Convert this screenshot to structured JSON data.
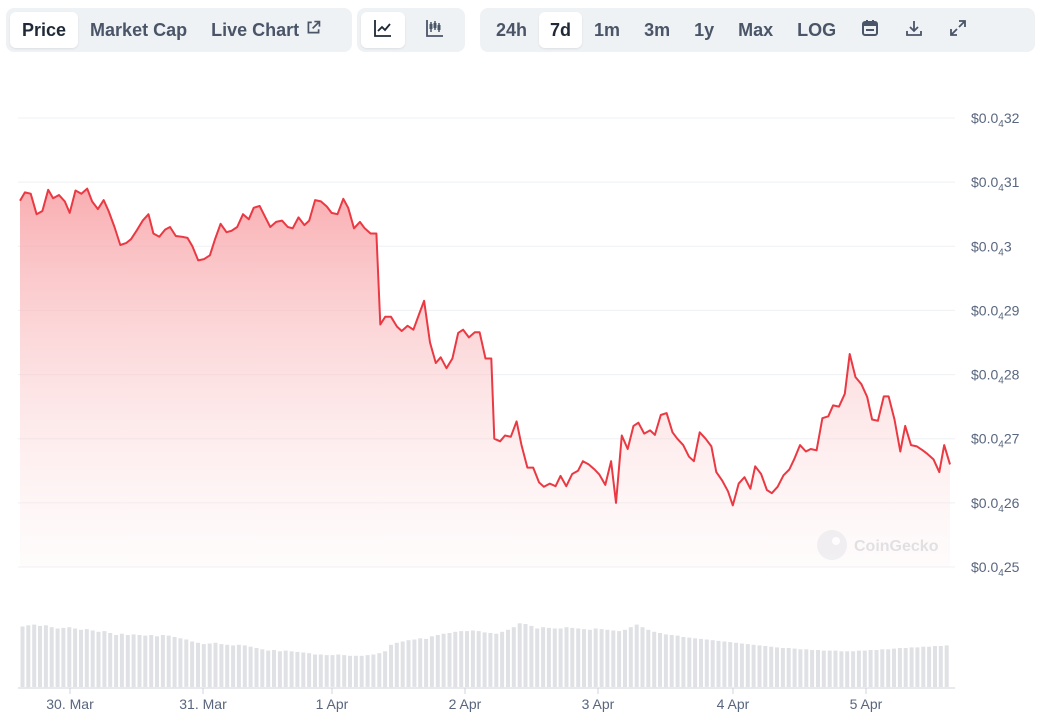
{
  "toolbar": {
    "metric_tabs": [
      {
        "label": "Price",
        "active": true
      },
      {
        "label": "Market Cap",
        "active": false
      },
      {
        "label": "Live Chart",
        "active": false,
        "icon": "external-link-icon"
      }
    ],
    "chart_type_buttons": [
      {
        "icon": "line-chart-icon",
        "active": true
      },
      {
        "icon": "candlestick-icon",
        "active": false
      }
    ],
    "range_buttons": [
      {
        "label": "24h",
        "active": false
      },
      {
        "label": "7d",
        "active": true
      },
      {
        "label": "1m",
        "active": false
      },
      {
        "label": "3m",
        "active": false
      },
      {
        "label": "1y",
        "active": false
      },
      {
        "label": "Max",
        "active": false
      },
      {
        "label": "LOG",
        "active": false
      }
    ],
    "action_icons": [
      "calendar-icon",
      "download-icon",
      "expand-icon"
    ]
  },
  "watermark": "CoinGecko",
  "colors": {
    "line": "#ea3943",
    "fill_top": "#f8a5a9",
    "grid": "#eef0f3",
    "volume": "#dfe1e5",
    "axis_text": "#58667e"
  },
  "chart_data": {
    "type": "area",
    "y_ticks": [
      {
        "prefix": "$0.0",
        "sub": "4",
        "suffix": "32",
        "value": 3.2e-05
      },
      {
        "prefix": "$0.0",
        "sub": "4",
        "suffix": "31",
        "value": 3.1e-05
      },
      {
        "prefix": "$0.0",
        "sub": "4",
        "suffix": "3",
        "value": 3e-05
      },
      {
        "prefix": "$0.0",
        "sub": "4",
        "suffix": "29",
        "value": 2.9e-05
      },
      {
        "prefix": "$0.0",
        "sub": "4",
        "suffix": "28",
        "value": 2.8e-05
      },
      {
        "prefix": "$0.0",
        "sub": "4",
        "suffix": "27",
        "value": 2.7e-05
      },
      {
        "prefix": "$0.0",
        "sub": "4",
        "suffix": "26",
        "value": 2.6e-05
      },
      {
        "prefix": "$0.0",
        "sub": "4",
        "suffix": "25",
        "value": 2.5e-05
      }
    ],
    "ylim": [
      2.5e-05,
      3.2e-05
    ],
    "x_ticks": [
      {
        "label": "30. Mar",
        "day": 0.5
      },
      {
        "label": "31. Mar",
        "day": 1.5
      },
      {
        "label": "1 Apr",
        "day": 2.5
      },
      {
        "label": "2 Apr",
        "day": 3.5
      },
      {
        "label": "3 Apr",
        "day": 4.5
      },
      {
        "label": "4 Apr",
        "day": 5.5
      },
      {
        "label": "5 Apr",
        "day": 6.5
      }
    ],
    "xlim": [
      0,
      7
    ],
    "price_points": [
      [
        0.0,
        0.03071
      ],
      [
        0.05,
        0.03084
      ],
      [
        0.11,
        0.03082
      ],
      [
        0.17,
        0.0305
      ],
      [
        0.23,
        0.03055
      ],
      [
        0.29,
        0.03088
      ],
      [
        0.34,
        0.03075
      ],
      [
        0.4,
        0.0308
      ],
      [
        0.46,
        0.0307
      ],
      [
        0.51,
        0.03052
      ],
      [
        0.57,
        0.03087
      ],
      [
        0.63,
        0.03082
      ],
      [
        0.69,
        0.0309
      ],
      [
        0.74,
        0.0307
      ],
      [
        0.8,
        0.03058
      ],
      [
        0.86,
        0.03072
      ],
      [
        0.91,
        0.03055
      ],
      [
        0.97,
        0.0303
      ],
      [
        1.03,
        0.03002
      ],
      [
        1.09,
        0.03005
      ],
      [
        1.14,
        0.03011
      ],
      [
        1.2,
        0.03025
      ],
      [
        1.26,
        0.0304
      ],
      [
        1.32,
        0.0305
      ],
      [
        1.37,
        0.0302
      ],
      [
        1.43,
        0.03015
      ],
      [
        1.49,
        0.03026
      ],
      [
        1.54,
        0.0303
      ],
      [
        1.6,
        0.03016
      ],
      [
        1.66,
        0.03015
      ],
      [
        1.72,
        0.03013
      ],
      [
        1.77,
        0.03
      ],
      [
        1.83,
        0.02978
      ],
      [
        1.89,
        0.0298
      ],
      [
        1.95,
        0.02986
      ],
      [
        2.0,
        0.0301
      ],
      [
        2.06,
        0.03035
      ],
      [
        2.12,
        0.03022
      ],
      [
        2.17,
        0.03024
      ],
      [
        2.23,
        0.0303
      ],
      [
        2.29,
        0.0305
      ],
      [
        2.35,
        0.03042
      ],
      [
        2.4,
        0.0306
      ],
      [
        2.46,
        0.03063
      ],
      [
        2.52,
        0.03045
      ],
      [
        2.57,
        0.0303
      ],
      [
        2.63,
        0.03038
      ],
      [
        2.69,
        0.0304
      ],
      [
        2.75,
        0.0303
      ],
      [
        2.8,
        0.03028
      ],
      [
        2.86,
        0.03045
      ],
      [
        2.92,
        0.03033
      ],
      [
        2.97,
        0.0304
      ],
      [
        3.03,
        0.03072
      ],
      [
        3.09,
        0.0307
      ],
      [
        3.15,
        0.03062
      ],
      [
        3.2,
        0.03052
      ],
      [
        3.26,
        0.0305
      ],
      [
        3.32,
        0.03074
      ],
      [
        3.37,
        0.0306
      ],
      [
        3.43,
        0.03028
      ],
      [
        3.49,
        0.03038
      ],
      [
        3.54,
        0.03028
      ],
      [
        3.6,
        0.0302
      ],
      [
        3.66,
        0.0302
      ],
      [
        3.7,
        0.02878
      ],
      [
        3.75,
        0.0289
      ],
      [
        3.81,
        0.0289
      ],
      [
        3.87,
        0.02875
      ],
      [
        3.92,
        0.02868
      ],
      [
        3.98,
        0.02876
      ],
      [
        4.04,
        0.0287
      ],
      [
        4.1,
        0.02895
      ],
      [
        4.15,
        0.02915
      ],
      [
        4.21,
        0.0285
      ],
      [
        4.27,
        0.02818
      ],
      [
        4.32,
        0.02827
      ],
      [
        4.38,
        0.0281
      ],
      [
        4.44,
        0.02825
      ],
      [
        4.5,
        0.02865
      ],
      [
        4.55,
        0.0287
      ],
      [
        4.61,
        0.02858
      ],
      [
        4.67,
        0.02866
      ],
      [
        4.72,
        0.02866
      ],
      [
        4.78,
        0.02825
      ],
      [
        4.84,
        0.02825
      ],
      [
        4.87,
        0.027
      ],
      [
        4.93,
        0.02696
      ],
      [
        4.98,
        0.02705
      ],
      [
        5.04,
        0.02703
      ],
      [
        5.1,
        0.02727
      ],
      [
        5.15,
        0.0269
      ],
      [
        5.21,
        0.02655
      ],
      [
        5.27,
        0.02655
      ],
      [
        5.33,
        0.02632
      ],
      [
        5.38,
        0.02625
      ],
      [
        5.44,
        0.0263
      ],
      [
        5.5,
        0.02626
      ],
      [
        5.55,
        0.02642
      ],
      [
        5.61,
        0.02626
      ],
      [
        5.67,
        0.02645
      ],
      [
        5.73,
        0.0265
      ],
      [
        5.78,
        0.02665
      ],
      [
        5.84,
        0.0266
      ],
      [
        5.9,
        0.02652
      ],
      [
        5.95,
        0.02644
      ],
      [
        6.01,
        0.02628
      ],
      [
        6.07,
        0.02665
      ],
      [
        6.12,
        0.026
      ],
      [
        6.18,
        0.02705
      ],
      [
        6.24,
        0.02684
      ],
      [
        6.3,
        0.0272
      ],
      [
        6.35,
        0.02725
      ],
      [
        6.41,
        0.02708
      ],
      [
        6.47,
        0.02713
      ],
      [
        6.52,
        0.02706
      ],
      [
        6.58,
        0.02737
      ],
      [
        6.64,
        0.0274
      ],
      [
        6.7,
        0.0271
      ],
      [
        6.75,
        0.027
      ],
      [
        6.81,
        0.0269
      ],
      [
        6.87,
        0.02672
      ],
      [
        6.92,
        0.02665
      ],
      [
        6.98,
        0.0271
      ],
      [
        7.04,
        0.027
      ],
      [
        7.1,
        0.02688
      ],
      [
        7.15,
        0.02648
      ],
      [
        7.21,
        0.02635
      ],
      [
        7.27,
        0.02618
      ],
      [
        7.32,
        0.02596
      ],
      [
        7.38,
        0.0263
      ],
      [
        7.44,
        0.0264
      ],
      [
        7.5,
        0.02622
      ],
      [
        7.55,
        0.02657
      ],
      [
        7.61,
        0.02645
      ],
      [
        7.67,
        0.0262
      ],
      [
        7.72,
        0.02615
      ],
      [
        7.78,
        0.02625
      ],
      [
        7.84,
        0.02643
      ],
      [
        7.9,
        0.02652
      ],
      [
        7.95,
        0.02668
      ],
      [
        8.01,
        0.0269
      ],
      [
        8.07,
        0.0268
      ],
      [
        8.12,
        0.02684
      ],
      [
        8.18,
        0.02682
      ],
      [
        8.24,
        0.02732
      ],
      [
        8.3,
        0.02735
      ],
      [
        8.35,
        0.02752
      ],
      [
        8.41,
        0.0275
      ],
      [
        8.47,
        0.0277
      ],
      [
        8.52,
        0.02832
      ],
      [
        8.58,
        0.02796
      ],
      [
        8.64,
        0.02785
      ],
      [
        8.7,
        0.02765
      ],
      [
        8.75,
        0.0273
      ],
      [
        8.81,
        0.02728
      ],
      [
        8.87,
        0.02766
      ],
      [
        8.92,
        0.02766
      ],
      [
        8.98,
        0.0273
      ],
      [
        9.04,
        0.0268
      ],
      [
        9.09,
        0.0272
      ],
      [
        9.15,
        0.0269
      ],
      [
        9.21,
        0.02688
      ],
      [
        9.27,
        0.02682
      ],
      [
        9.32,
        0.02676
      ],
      [
        9.38,
        0.02668
      ],
      [
        9.44,
        0.02648
      ],
      [
        9.49,
        0.0269
      ],
      [
        9.55,
        0.0266
      ]
    ],
    "volume_relative": [
      0.93,
      0.95,
      0.96,
      0.94,
      0.95,
      0.92,
      0.9,
      0.91,
      0.92,
      0.9,
      0.88,
      0.89,
      0.87,
      0.85,
      0.86,
      0.83,
      0.8,
      0.82,
      0.8,
      0.81,
      0.8,
      0.79,
      0.8,
      0.78,
      0.8,
      0.79,
      0.77,
      0.75,
      0.73,
      0.7,
      0.68,
      0.66,
      0.67,
      0.68,
      0.66,
      0.65,
      0.64,
      0.65,
      0.64,
      0.62,
      0.6,
      0.58,
      0.56,
      0.57,
      0.55,
      0.56,
      0.55,
      0.54,
      0.53,
      0.52,
      0.5,
      0.5,
      0.49,
      0.49,
      0.5,
      0.49,
      0.48,
      0.48,
      0.48,
      0.49,
      0.5,
      0.52,
      0.55,
      0.65,
      0.68,
      0.7,
      0.72,
      0.73,
      0.75,
      0.74,
      0.78,
      0.8,
      0.82,
      0.83,
      0.85,
      0.86,
      0.86,
      0.87,
      0.86,
      0.84,
      0.83,
      0.82,
      0.85,
      0.88,
      0.92,
      0.98,
      0.97,
      0.94,
      0.9,
      0.92,
      0.91,
      0.9,
      0.9,
      0.92,
      0.91,
      0.9,
      0.89,
      0.88,
      0.9,
      0.89,
      0.88,
      0.87,
      0.86,
      0.88,
      0.92,
      0.96,
      0.92,
      0.88,
      0.85,
      0.83,
      0.81,
      0.8,
      0.79,
      0.77,
      0.76,
      0.75,
      0.74,
      0.73,
      0.72,
      0.71,
      0.7,
      0.69,
      0.68,
      0.67,
      0.66,
      0.65,
      0.64,
      0.63,
      0.62,
      0.61,
      0.6,
      0.6,
      0.59,
      0.58,
      0.58,
      0.57,
      0.57,
      0.56,
      0.56,
      0.56,
      0.55,
      0.55,
      0.55,
      0.56,
      0.56,
      0.57,
      0.57,
      0.58,
      0.58,
      0.59,
      0.6,
      0.6,
      0.61,
      0.61,
      0.62,
      0.62,
      0.63,
      0.63,
      0.64
    ]
  }
}
